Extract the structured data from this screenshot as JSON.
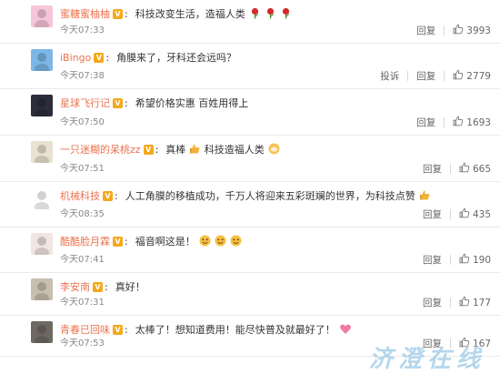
{
  "comments": [
    {
      "user": "蜜糖蜜柚柚",
      "text": "科技改变生活，造福人类",
      "emoji": [
        "rose-icon",
        "rose-icon",
        "rose-icon"
      ],
      "time": "今天07:33",
      "actions": [
        "回复"
      ],
      "likes": "3993"
    },
    {
      "user": "iBingo",
      "text": "角膜来了，牙科还会远吗？",
      "emoji": [],
      "time": "今天07:38",
      "actions": [
        "投诉",
        "回复"
      ],
      "likes": "2779"
    },
    {
      "user": "星球飞行记",
      "text": "希望价格实惠 百姓用得上",
      "emoji": [],
      "time": "今天07:50",
      "actions": [
        "回复"
      ],
      "likes": "1693"
    },
    {
      "user": "一只迷糊的呆桃zz",
      "text": "真棒",
      "text2": "科技造福人类",
      "emoji": [
        "thumbs-up-icon"
      ],
      "emoji2": [
        "clap-emoji-icon"
      ],
      "time": "今天07:51",
      "actions": [
        "回复"
      ],
      "likes": "665"
    },
    {
      "user": "机械科技",
      "text": "人工角膜的移植成功，千万人将迎来五彩斑斓的世界，为科技点赞",
      "emoji": [
        "thumbs-up-icon"
      ],
      "time": "今天08:35",
      "actions": [
        "回复"
      ],
      "likes": "435"
    },
    {
      "user": "酷酷脸月霖",
      "text": "福音啊这是！",
      "emoji": [
        "face-emoji-icon",
        "face-emoji-icon",
        "face-emoji-icon"
      ],
      "time": "今天07:41",
      "actions": [
        "回复"
      ],
      "likes": "190"
    },
    {
      "user": "李安南",
      "text": "真好！",
      "emoji": [],
      "time": "今天07:31",
      "actions": [
        "回复"
      ],
      "likes": "177"
    },
    {
      "user": "青春已回味",
      "text": "太棒了！想知道费用！能尽快普及就最好了！",
      "emoji": [
        "heart-emoji-icon"
      ],
      "time": "今天07:53",
      "actions": [
        "回复"
      ],
      "likes": "167"
    }
  ],
  "watermark": "济澄在线",
  "colors": {
    "username": "#eb7350",
    "vbadge": "#f4a91a",
    "time": "#888888",
    "text": "#333333"
  }
}
